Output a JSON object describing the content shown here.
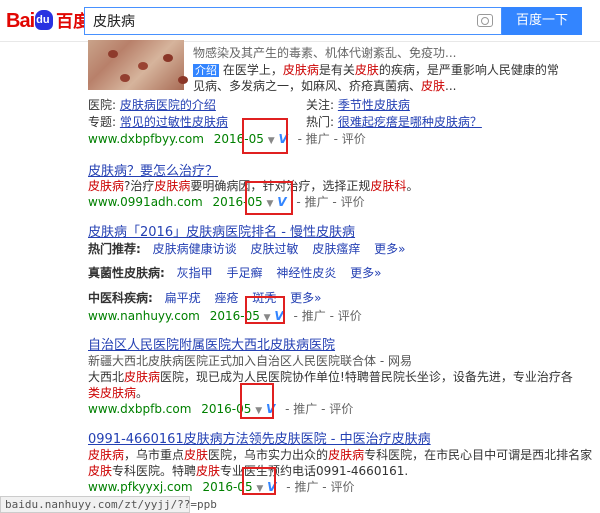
{
  "logo": {
    "text_a": "Bai",
    "text_b": "百度"
  },
  "search": {
    "query": "皮肤病",
    "button": "百度一下"
  },
  "result1": {
    "snippet_l1": "物感染及其产生的毒素、机体代谢紊乱、免疫功...",
    "tag": "介绍",
    "snippet_l2_a": "在医学上，",
    "snippet_l2_hl": "皮肤病",
    "snippet_l2_b": "是有关",
    "snippet_l2_hl2": "皮肤",
    "snippet_l2_c": "的疾病，是严重影响人民健康的常",
    "snippet_l3_a": "见病、多发病之一，如麻风、疥疮真菌病、",
    "snippet_l3_hl": "皮肤",
    "snippet_l3_b": "...",
    "hospital_label": "医院:",
    "hospital_link": "皮肤病医院的介绍",
    "focus_label": "关注:",
    "focus_link": "季节性皮肤病",
    "topic_label": "专题:",
    "topic_link": "常见的过敏性皮肤病",
    "hot_label": "热门:",
    "hot_link": "很难起疙瘩是哪种皮肤病？",
    "url": "www.dxbpfbyy.com",
    "date": "2016-05",
    "promo": "推广",
    "review": "评价"
  },
  "result2": {
    "title": "皮肤病？要怎么治疗？",
    "snippet_a": "皮肤病",
    "snippet_b": "?治疗",
    "snippet_c": "皮肤病",
    "snippet_d": "要明确病因，针对治疗，选择正规",
    "snippet_e": "皮肤科",
    "snippet_f": "。",
    "url": "www.0991adh.com",
    "date": "2016-05",
    "promo": "推广",
    "review": "评价"
  },
  "result3": {
    "title": "皮肤病「2016」皮肤病医院排名 - 慢性皮肤病",
    "row1_label": "热门推荐:",
    "row1_items": [
      "皮肤病健康访谈",
      "皮肤过敏",
      "皮肤瘙痒",
      "更多»"
    ],
    "row2_label": "真菌性皮肤病:",
    "row2_items": [
      "灰指甲",
      "手足癣",
      "神经性皮炎",
      "更多»"
    ],
    "row3_label": "中医科疾病:",
    "row3_items": [
      "扁平疣",
      "痤疮",
      "斑秃",
      "更多»"
    ],
    "url": "www.nanhuyy.com",
    "date": "2016-05",
    "promo": "推广",
    "review": "评价"
  },
  "result4": {
    "title": "自治区人民医院附属医院大西北皮肤病医院",
    "l1": "新疆大西北皮肤病医院正式加入自治区人民医院联合体 - 网易",
    "l2_a": "大西北",
    "l2_hl": "皮肤病",
    "l2_b": "医院，现已成为人民医院协作单位!特聘普民院长坐诊，设备先进，专业治疗各",
    "l3_hl": "类皮肤病",
    "l3_b": "。",
    "url": "www.dxbpfb.com",
    "date": "2016-05",
    "promo": "推广",
    "review": "评价"
  },
  "result5": {
    "title": "0991-4660161皮肤病方法领先皮肤医院 - 中医治疗皮肤病",
    "l1_hl": "皮肤病",
    "l1_b": "，乌市重点",
    "l1_hl2": "皮肤",
    "l1_c": "医院，乌市实力出众的",
    "l1_hl3": "皮肤病",
    "l1_d": "专科医院，在市民心目中可谓是西北排名家",
    "l2_hl": "皮肤",
    "l2_b": "专科医院。特聘",
    "l2_hl2": "皮肤",
    "l2_c": "专业医生预约电话0991-4660161.",
    "url": "www.pfkyyxj.com",
    "date": "2016-05",
    "promo": "推广",
    "review": "评价"
  },
  "status_url": "baidu.nanhuyy.com/zt/yyjj/??=ppb"
}
